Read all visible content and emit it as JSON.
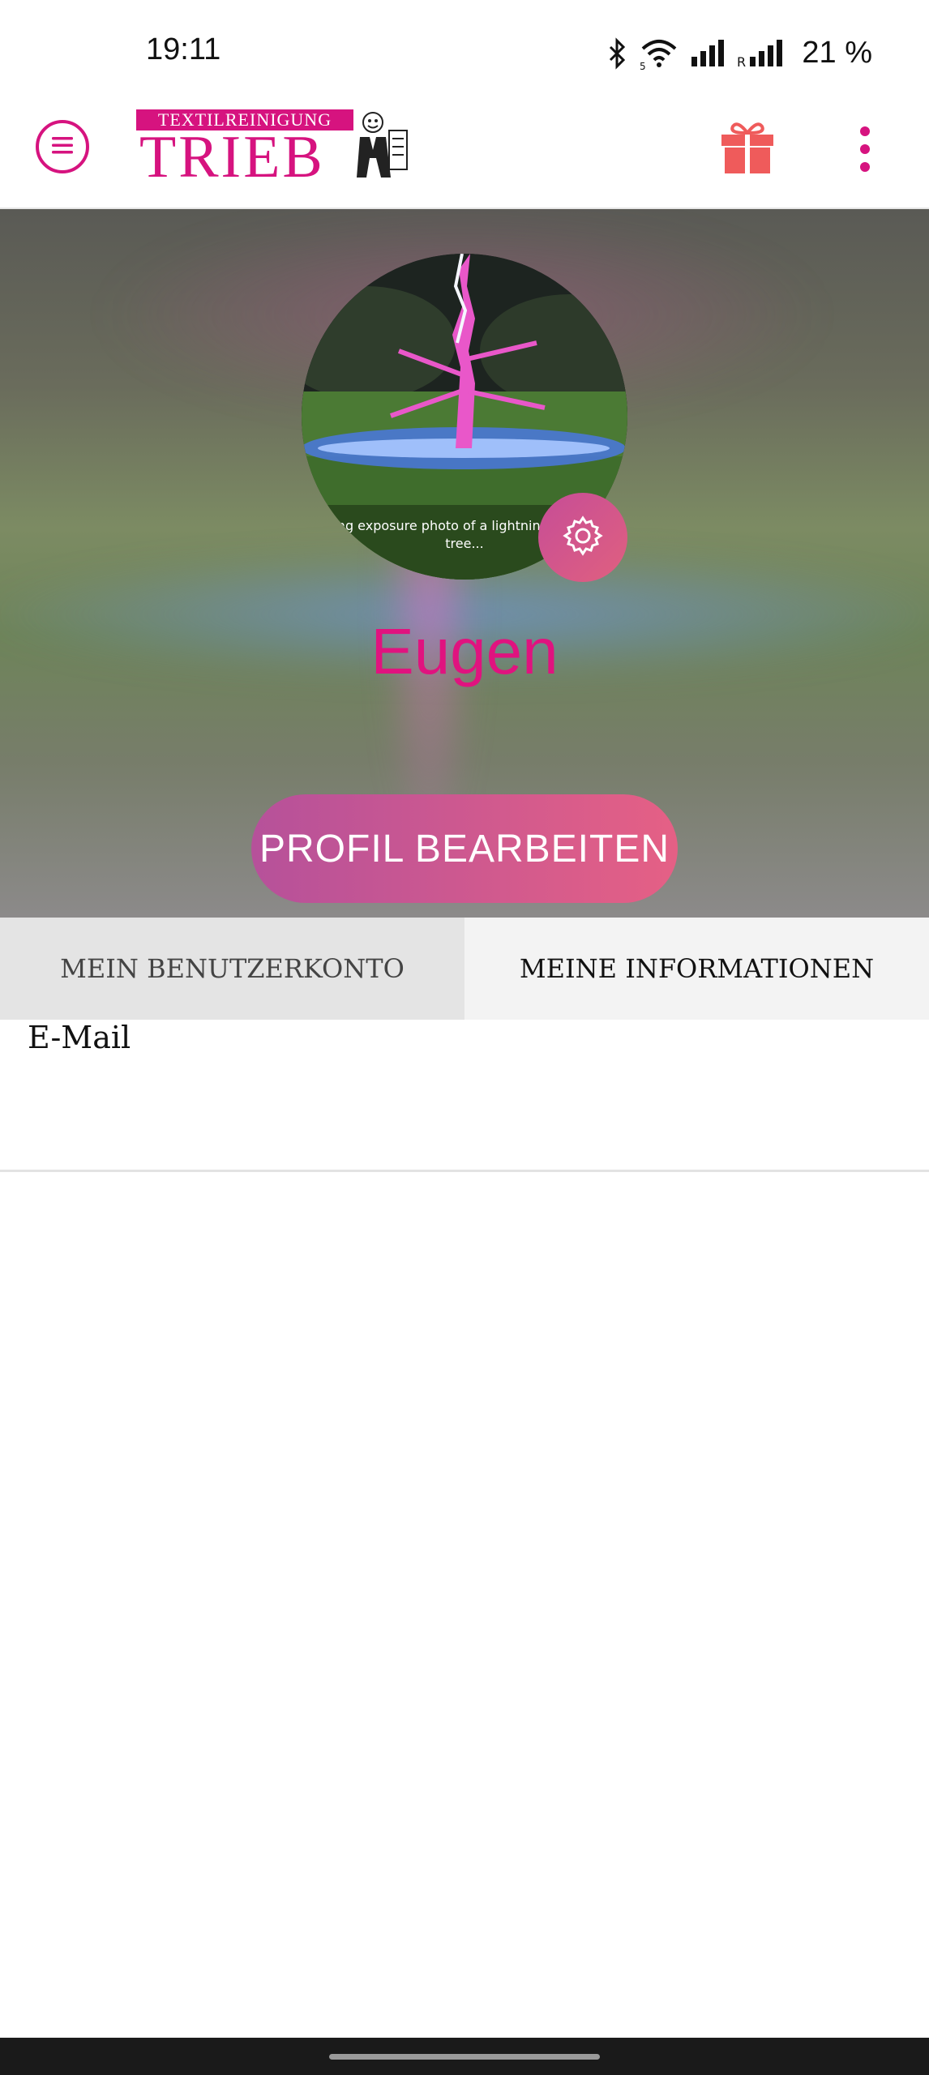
{
  "status_bar": {
    "time": "19:11",
    "battery": "21 %",
    "icons": [
      "bluetooth-icon",
      "wifi-icon",
      "signal-icon",
      "signal-roaming-icon"
    ]
  },
  "app_bar": {
    "logo_banner": "TEXTILREINIGUNG",
    "logo_word": "TRIEB",
    "icons": [
      "menu-icon",
      "gift-icon",
      "more-vert-icon"
    ],
    "accent_color": "#d6137f",
    "gift_color": "#ef5b5b"
  },
  "profile": {
    "avatar_caption": "Long exposure photo of a lightning hitting a tree...",
    "name": "Eugen",
    "edit_button_label": "PROFIL BEARBEITEN",
    "settings_icon": "gear-icon"
  },
  "tabs": [
    {
      "label": "MEIN BENUTZERKONTO",
      "active": false
    },
    {
      "label": "MEINE INFORMATIONEN",
      "active": true
    }
  ],
  "content": {
    "email_label": "E-Mail"
  }
}
